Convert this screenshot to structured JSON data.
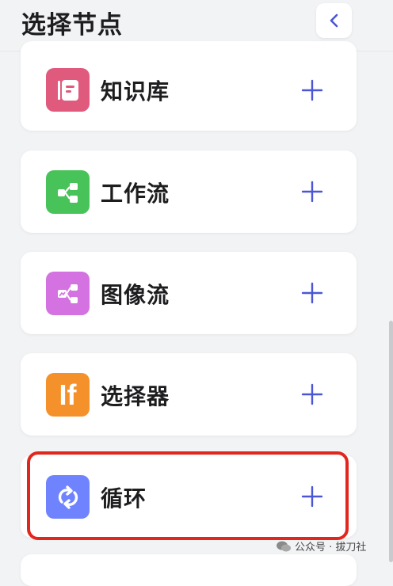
{
  "header": {
    "title": "选择节点",
    "back_icon": "chevron-left-icon"
  },
  "nodes": [
    {
      "label": "知识库",
      "icon": "knowledge-base-icon",
      "color": "#e05a7e"
    },
    {
      "label": "工作流",
      "icon": "workflow-icon",
      "color": "#48c35a"
    },
    {
      "label": "图像流",
      "icon": "image-flow-icon",
      "color": "#d372e0"
    },
    {
      "label": "选择器",
      "icon": "selector-if-icon",
      "color": "#f5912a",
      "icon_text": "If"
    },
    {
      "label": "循环",
      "icon": "loop-icon",
      "color": "#6f83ff",
      "highlighted": true
    }
  ],
  "colors": {
    "accent": "#4a56d6",
    "highlight": "#e3261d"
  },
  "watermark": {
    "text": "公众号 · 拔刀社"
  }
}
